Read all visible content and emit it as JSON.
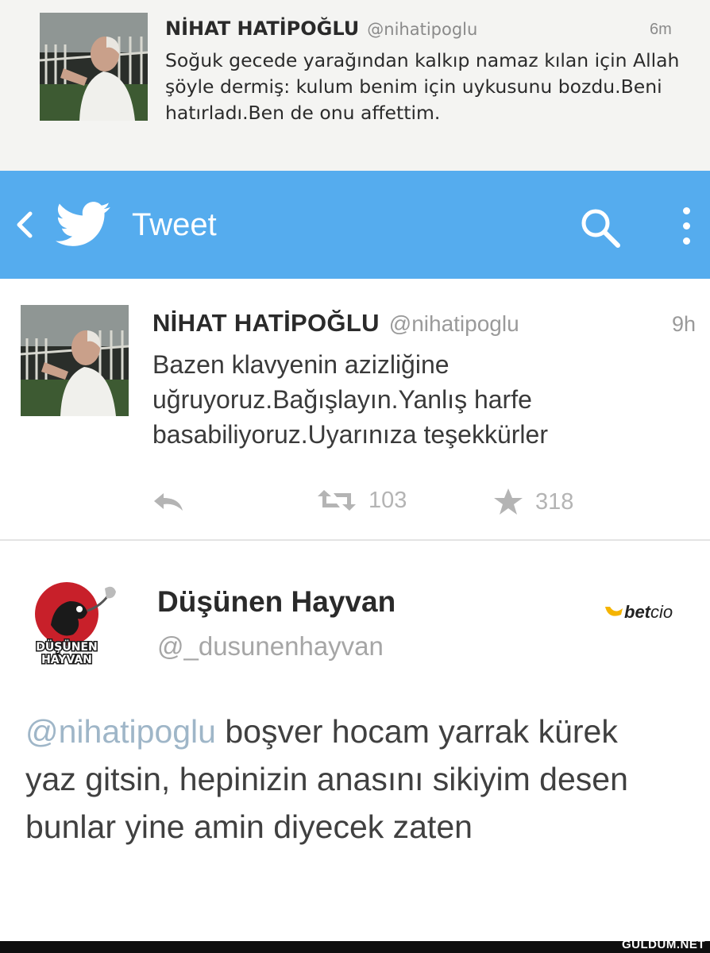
{
  "top_tweet": {
    "name": "NİHAT HATİPOĞLU",
    "handle": "@nihatipoglu",
    "time": "6m",
    "text": "Soğuk gecede yarağından kalkıp namaz kılan için Allah şöyle dermiş: kulum benim için uykusunu bozdu.Beni hatırladı.Ben de onu affettim."
  },
  "appbar": {
    "title": "Tweet",
    "color": "#55acee"
  },
  "main_tweet": {
    "name": "NİHAT HATİPOĞLU",
    "handle": "@nihatipoglu",
    "time": "9h",
    "text": "Bazen klavyenin azizliğine uğruyoruz.Bağışlayın.Yanlış harfe basabiliyoruz.Uyarınıza teşekkürler",
    "retweets": "103",
    "favorites": "318"
  },
  "reply_tweet": {
    "name": "Düşünen Hayvan",
    "handle": "@_dusunenhayvan",
    "avatar_text_1": "DÜŞÜNEN",
    "avatar_text_2": "HAYVAN",
    "mention": "@nihatipoglu",
    "text": " boşver hocam yarrak kürek yaz gitsin, hepinizin anasını sikiyim desen bunlar yine amin diyecek zaten"
  },
  "ad": {
    "brand_bold": "bet",
    "brand_light": "cio"
  },
  "footer": {
    "watermark": "GULDUM.NET"
  }
}
